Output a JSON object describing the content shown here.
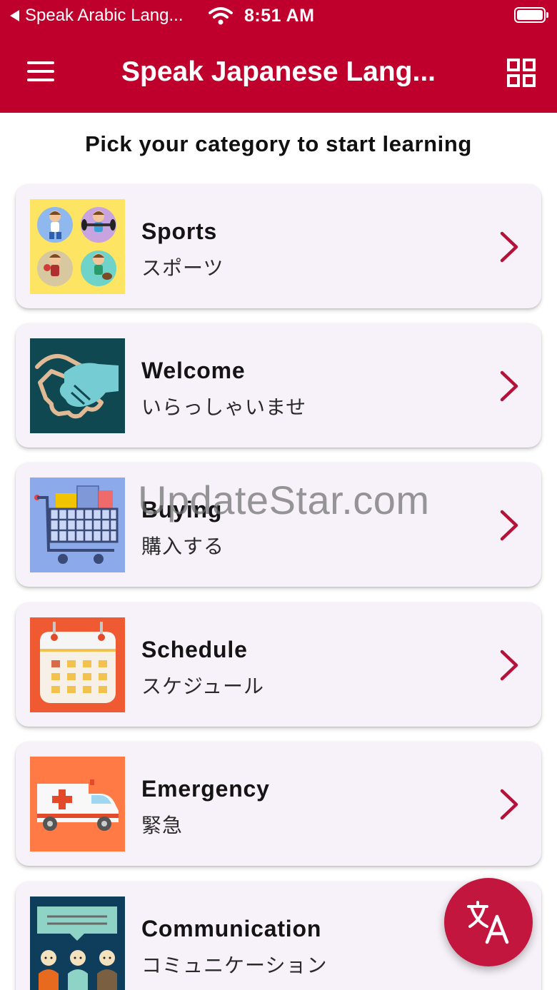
{
  "status_bar": {
    "back_label": "Speak Arabic Lang...",
    "time": "8:51 AM"
  },
  "app_bar": {
    "title": "Speak Japanese Lang..."
  },
  "subtitle": "Pick your category to start learning",
  "categories": [
    {
      "title": "Sports",
      "jp": "スポーツ",
      "icon": "sports-icon"
    },
    {
      "title": "Welcome",
      "jp": "いらっしゃいませ",
      "icon": "handshake-icon"
    },
    {
      "title": "Buying",
      "jp": "購入する",
      "icon": "shopping-cart-icon"
    },
    {
      "title": "Schedule",
      "jp": "スケジュール",
      "icon": "calendar-icon"
    },
    {
      "title": "Emergency",
      "jp": "緊急",
      "icon": "ambulance-icon"
    },
    {
      "title": "Communication",
      "jp": "コミュニケーション",
      "icon": "communication-icon"
    }
  ],
  "watermark": "UpdateStar.com",
  "colors": {
    "primary": "#c0002c",
    "card_bg": "#f7f2f9",
    "chevron": "#b5123a",
    "fab": "#c3163f"
  }
}
